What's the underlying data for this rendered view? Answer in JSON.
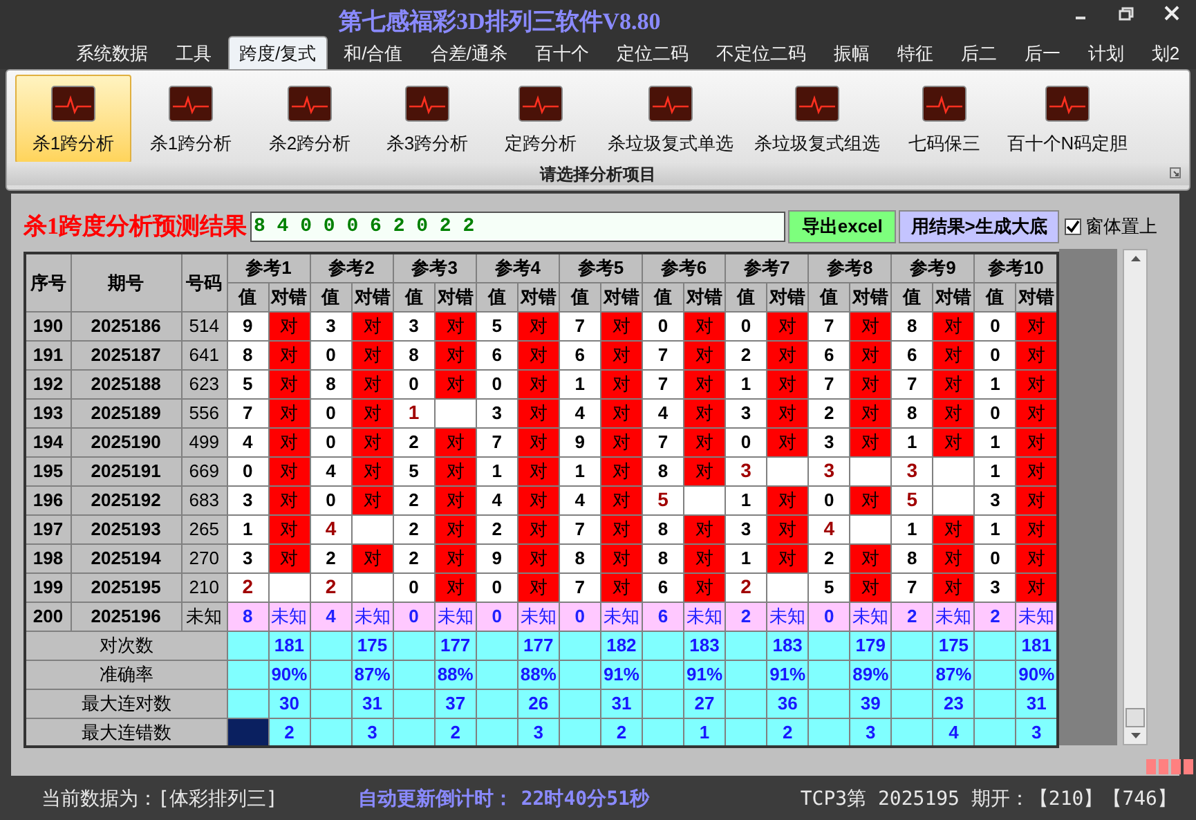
{
  "window": {
    "title": "第七感福彩3D排列三软件V8.80"
  },
  "menu": [
    {
      "label": "系统数据",
      "selected": false
    },
    {
      "label": "工具",
      "selected": false
    },
    {
      "label": "跨度/复式",
      "selected": true
    },
    {
      "label": "和/合值",
      "selected": false
    },
    {
      "label": "合差/通杀",
      "selected": false
    },
    {
      "label": "百十个",
      "selected": false
    },
    {
      "label": "定位二码",
      "selected": false
    },
    {
      "label": "不定位二码",
      "selected": false
    },
    {
      "label": "振幅",
      "selected": false
    },
    {
      "label": "特征",
      "selected": false
    },
    {
      "label": "后二",
      "selected": false
    },
    {
      "label": "后一",
      "selected": false
    },
    {
      "label": "计划",
      "selected": false
    },
    {
      "label": "划2",
      "selected": false
    }
  ],
  "ribbon": {
    "caption": "请选择分析项目",
    "items": [
      {
        "label": "杀1跨分析",
        "selected": true
      },
      {
        "label": "杀1跨分析",
        "selected": false
      },
      {
        "label": "杀2跨分析",
        "selected": false
      },
      {
        "label": "杀3跨分析",
        "selected": false
      },
      {
        "label": "定跨分析",
        "selected": false
      },
      {
        "label": "杀垃圾复式单选",
        "selected": false
      },
      {
        "label": "杀垃圾复式组选",
        "selected": false
      },
      {
        "label": "七码保三",
        "selected": false
      },
      {
        "label": "百十个N码定胆",
        "selected": false
      }
    ]
  },
  "result": {
    "title": "杀1跨度分析预测结果",
    "value": "8 4 0 0 0 6 2 0 2 2",
    "export_button": "导出excel",
    "generate_button": "用结果>生成大底",
    "stay_on_top": {
      "label": "窗体置上",
      "checked": true
    }
  },
  "table": {
    "columns": [
      "序号",
      "期号",
      "号码"
    ],
    "refs": [
      "参考1",
      "参考2",
      "参考3",
      "参考4",
      "参考5",
      "参考6",
      "参考7",
      "参考8",
      "参考9",
      "参考10"
    ],
    "sub_columns": [
      "值",
      "对错",
      "值",
      "对错",
      "值",
      "对错",
      "值",
      "对错",
      "值",
      "对错",
      "值",
      "对错",
      "值",
      "对错",
      "值",
      "对错",
      "值",
      "对错",
      "值",
      "对错"
    ],
    "rows": [
      {
        "kind": "done",
        "no": "190",
        "issue": "2025186",
        "code": "514",
        "cells": [
          {
            "value": "9",
            "hit": true,
            "result": "对"
          },
          {
            "value": "3",
            "hit": true,
            "result": "对"
          },
          {
            "value": "3",
            "hit": true,
            "result": "对"
          },
          {
            "value": "5",
            "hit": true,
            "result": "对"
          },
          {
            "value": "7",
            "hit": true,
            "result": "对"
          },
          {
            "value": "0",
            "hit": true,
            "result": "对"
          },
          {
            "value": "0",
            "hit": true,
            "result": "对"
          },
          {
            "value": "7",
            "hit": true,
            "result": "对"
          },
          {
            "value": "8",
            "hit": true,
            "result": "对"
          },
          {
            "value": "0",
            "hit": true,
            "result": "对"
          }
        ]
      },
      {
        "kind": "done",
        "no": "191",
        "issue": "2025187",
        "code": "641",
        "cells": [
          {
            "value": "8",
            "hit": true,
            "result": "对"
          },
          {
            "value": "0",
            "hit": true,
            "result": "对"
          },
          {
            "value": "8",
            "hit": true,
            "result": "对"
          },
          {
            "value": "6",
            "hit": true,
            "result": "对"
          },
          {
            "value": "6",
            "hit": true,
            "result": "对"
          },
          {
            "value": "7",
            "hit": true,
            "result": "对"
          },
          {
            "value": "2",
            "hit": true,
            "result": "对"
          },
          {
            "value": "6",
            "hit": true,
            "result": "对"
          },
          {
            "value": "6",
            "hit": true,
            "result": "对"
          },
          {
            "value": "0",
            "hit": true,
            "result": "对"
          }
        ]
      },
      {
        "kind": "done",
        "no": "192",
        "issue": "2025188",
        "code": "623",
        "cells": [
          {
            "value": "5",
            "hit": true,
            "result": "对"
          },
          {
            "value": "8",
            "hit": true,
            "result": "对"
          },
          {
            "value": "0",
            "hit": true,
            "result": "对"
          },
          {
            "value": "0",
            "hit": true,
            "result": "对"
          },
          {
            "value": "1",
            "hit": true,
            "result": "对"
          },
          {
            "value": "7",
            "hit": true,
            "result": "对"
          },
          {
            "value": "1",
            "hit": true,
            "result": "对"
          },
          {
            "value": "7",
            "hit": true,
            "result": "对"
          },
          {
            "value": "7",
            "hit": true,
            "result": "对"
          },
          {
            "value": "1",
            "hit": true,
            "result": "对"
          }
        ]
      },
      {
        "kind": "done",
        "no": "193",
        "issue": "2025189",
        "code": "556",
        "cells": [
          {
            "value": "7",
            "hit": true,
            "result": "对"
          },
          {
            "value": "0",
            "hit": true,
            "result": "对"
          },
          {
            "value": "1",
            "hit": false
          },
          {
            "value": "3",
            "hit": true,
            "result": "对"
          },
          {
            "value": "4",
            "hit": true,
            "result": "对"
          },
          {
            "value": "4",
            "hit": true,
            "result": "对"
          },
          {
            "value": "3",
            "hit": true,
            "result": "对"
          },
          {
            "value": "2",
            "hit": true,
            "result": "对"
          },
          {
            "value": "8",
            "hit": true,
            "result": "对"
          },
          {
            "value": "0",
            "hit": true,
            "result": "对"
          }
        ]
      },
      {
        "kind": "done",
        "no": "194",
        "issue": "2025190",
        "code": "499",
        "cells": [
          {
            "value": "4",
            "hit": true,
            "result": "对"
          },
          {
            "value": "0",
            "hit": true,
            "result": "对"
          },
          {
            "value": "2",
            "hit": true,
            "result": "对"
          },
          {
            "value": "7",
            "hit": true,
            "result": "对"
          },
          {
            "value": "9",
            "hit": true,
            "result": "对"
          },
          {
            "value": "7",
            "hit": true,
            "result": "对"
          },
          {
            "value": "0",
            "hit": true,
            "result": "对"
          },
          {
            "value": "3",
            "hit": true,
            "result": "对"
          },
          {
            "value": "1",
            "hit": true,
            "result": "对"
          },
          {
            "value": "1",
            "hit": true,
            "result": "对"
          }
        ]
      },
      {
        "kind": "done",
        "no": "195",
        "issue": "2025191",
        "code": "669",
        "cells": [
          {
            "value": "0",
            "hit": true,
            "result": "对"
          },
          {
            "value": "4",
            "hit": true,
            "result": "对"
          },
          {
            "value": "5",
            "hit": true,
            "result": "对"
          },
          {
            "value": "1",
            "hit": true,
            "result": "对"
          },
          {
            "value": "1",
            "hit": true,
            "result": "对"
          },
          {
            "value": "8",
            "hit": true,
            "result": "对"
          },
          {
            "value": "3",
            "hit": false
          },
          {
            "value": "3",
            "hit": false
          },
          {
            "value": "3",
            "hit": false
          },
          {
            "value": "1",
            "hit": true,
            "result": "对"
          }
        ]
      },
      {
        "kind": "done",
        "no": "196",
        "issue": "2025192",
        "code": "683",
        "cells": [
          {
            "value": "3",
            "hit": true,
            "result": "对"
          },
          {
            "value": "0",
            "hit": true,
            "result": "对"
          },
          {
            "value": "2",
            "hit": true,
            "result": "对"
          },
          {
            "value": "4",
            "hit": true,
            "result": "对"
          },
          {
            "value": "4",
            "hit": true,
            "result": "对"
          },
          {
            "value": "5",
            "hit": false
          },
          {
            "value": "1",
            "hit": true,
            "result": "对"
          },
          {
            "value": "0",
            "hit": true,
            "result": "对"
          },
          {
            "value": "5",
            "hit": false
          },
          {
            "value": "3",
            "hit": true,
            "result": "对"
          }
        ]
      },
      {
        "kind": "done",
        "no": "197",
        "issue": "2025193",
        "code": "265",
        "cells": [
          {
            "value": "1",
            "hit": true,
            "result": "对"
          },
          {
            "value": "4",
            "hit": false
          },
          {
            "value": "2",
            "hit": true,
            "result": "对"
          },
          {
            "value": "2",
            "hit": true,
            "result": "对"
          },
          {
            "value": "7",
            "hit": true,
            "result": "对"
          },
          {
            "value": "8",
            "hit": true,
            "result": "对"
          },
          {
            "value": "3",
            "hit": true,
            "result": "对"
          },
          {
            "value": "4",
            "hit": false
          },
          {
            "value": "1",
            "hit": true,
            "result": "对"
          },
          {
            "value": "1",
            "hit": true,
            "result": "对"
          }
        ]
      },
      {
        "kind": "done",
        "no": "198",
        "issue": "2025194",
        "code": "270",
        "cells": [
          {
            "value": "3",
            "hit": true,
            "result": "对"
          },
          {
            "value": "2",
            "hit": true,
            "result": "对"
          },
          {
            "value": "2",
            "hit": true,
            "result": "对"
          },
          {
            "value": "9",
            "hit": true,
            "result": "对"
          },
          {
            "value": "8",
            "hit": true,
            "result": "对"
          },
          {
            "value": "8",
            "hit": true,
            "result": "对"
          },
          {
            "value": "1",
            "hit": true,
            "result": "对"
          },
          {
            "value": "2",
            "hit": true,
            "result": "对"
          },
          {
            "value": "8",
            "hit": true,
            "result": "对"
          },
          {
            "value": "0",
            "hit": true,
            "result": "对"
          }
        ]
      },
      {
        "kind": "done",
        "no": "199",
        "issue": "2025195",
        "code": "210",
        "cells": [
          {
            "value": "2",
            "hit": false
          },
          {
            "value": "2",
            "hit": false
          },
          {
            "value": "0",
            "hit": true,
            "result": "对"
          },
          {
            "value": "0",
            "hit": true,
            "result": "对"
          },
          {
            "value": "7",
            "hit": true,
            "result": "对"
          },
          {
            "value": "6",
            "hit": true,
            "result": "对"
          },
          {
            "value": "2",
            "hit": false
          },
          {
            "value": "5",
            "hit": true,
            "result": "对"
          },
          {
            "value": "7",
            "hit": true,
            "result": "对"
          },
          {
            "value": "3",
            "hit": true,
            "result": "对"
          }
        ]
      },
      {
        "kind": "pending",
        "no": "200",
        "issue": "2025196",
        "code": "未知",
        "cells": [
          {
            "value": "8",
            "result": "未知"
          },
          {
            "value": "4",
            "result": "未知"
          },
          {
            "value": "0",
            "result": "未知"
          },
          {
            "value": "0",
            "result": "未知"
          },
          {
            "value": "0",
            "result": "未知"
          },
          {
            "value": "6",
            "result": "未知"
          },
          {
            "value": "2",
            "result": "未知"
          },
          {
            "value": "0",
            "result": "未知"
          },
          {
            "value": "2",
            "result": "未知"
          },
          {
            "value": "2",
            "result": "未知"
          }
        ]
      }
    ],
    "stats": [
      {
        "label": "对次数",
        "selected": false,
        "values": [
          "181",
          "175",
          "177",
          "177",
          "182",
          "183",
          "183",
          "179",
          "175",
          "181"
        ]
      },
      {
        "label": "准确率",
        "selected": false,
        "values": [
          "90%",
          "87%",
          "88%",
          "88%",
          "91%",
          "91%",
          "91%",
          "89%",
          "87%",
          "90%"
        ]
      },
      {
        "label": "最大连对数",
        "selected": false,
        "values": [
          "30",
          "31",
          "37",
          "26",
          "31",
          "27",
          "36",
          "39",
          "23",
          "31"
        ]
      },
      {
        "label": "最大连错数",
        "selected": true,
        "values": [
          "2",
          "3",
          "2",
          "3",
          "2",
          "1",
          "2",
          "3",
          "4",
          "3"
        ]
      }
    ]
  },
  "status_bar": {
    "current_data": "当前数据为：[体彩排列三]",
    "countdown_label": "自动更新倒计时：",
    "countdown": "22时40分51秒",
    "latest": "TCP3第 2025195 期开：【210】【746】"
  }
}
